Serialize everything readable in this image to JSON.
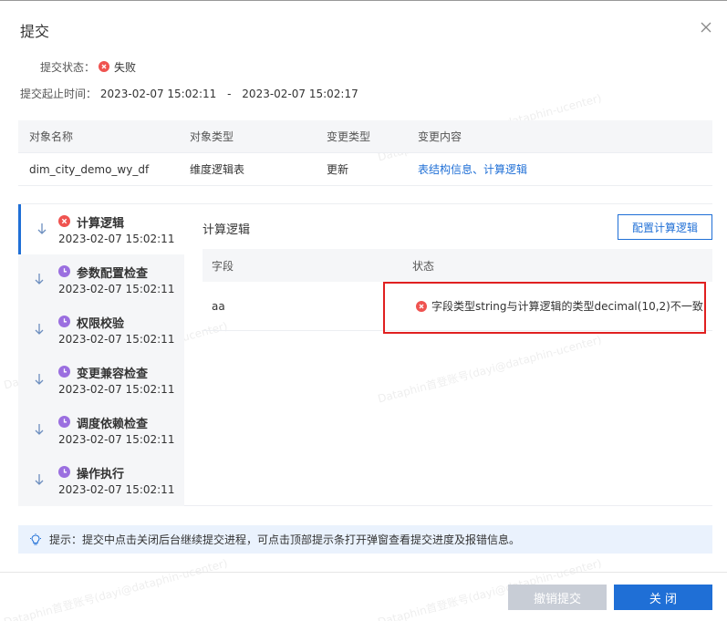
{
  "dialog": {
    "title": "提交",
    "status_label": "提交状态：",
    "status_value": "失败",
    "time_label": "提交起止时间：",
    "time_start": "2023-02-07 15:02:11",
    "time_sep": "-",
    "time_end": "2023-02-07 15:02:17"
  },
  "objects": {
    "headers": [
      "对象名称",
      "对象类型",
      "变更类型",
      "变更内容"
    ],
    "rows": [
      {
        "name": "dim_city_demo_wy_df",
        "type": "维度逻辑表",
        "change": "更新",
        "content": "表结构信息、计算逻辑"
      }
    ]
  },
  "steps": [
    {
      "name": "计算逻辑",
      "time": "2023-02-07 15:02:11",
      "status": "error"
    },
    {
      "name": "参数配置检查",
      "time": "2023-02-07 15:02:11",
      "status": "pending"
    },
    {
      "name": "权限校验",
      "time": "2023-02-07 15:02:11",
      "status": "pending"
    },
    {
      "name": "变更兼容检查",
      "time": "2023-02-07 15:02:11",
      "status": "pending"
    },
    {
      "name": "调度依赖检查",
      "time": "2023-02-07 15:02:11",
      "status": "pending"
    },
    {
      "name": "操作执行",
      "time": "2023-02-07 15:02:11",
      "status": "pending"
    }
  ],
  "detail": {
    "title": "计算逻辑",
    "config_button": "配置计算逻辑",
    "headers": [
      "字段",
      "状态"
    ],
    "rows": [
      {
        "field": "aa",
        "status": "字段类型string与计算逻辑的类型decimal(10,2)不一致"
      }
    ]
  },
  "tip": "提示：提交中点击关闭后台继续提交进程，可点击顶部提示条打开弹窗查看提交进度及报错信息。",
  "footer": {
    "cancel_label": "撤销提交",
    "close_label": "关 闭"
  },
  "watermark": "Dataphin首登账号(dayi@dataphin-ucenter)",
  "colors": {
    "primary": "#1f6fd6",
    "error": "#ef5350",
    "pending": "#9b6fe0",
    "highlight_box": "#e02020"
  },
  "icons": {
    "close": "close-icon",
    "error": "error-circle-icon",
    "pending": "clock-icon",
    "expand": "arrow-down-icon",
    "tip": "lightbulb-icon"
  }
}
